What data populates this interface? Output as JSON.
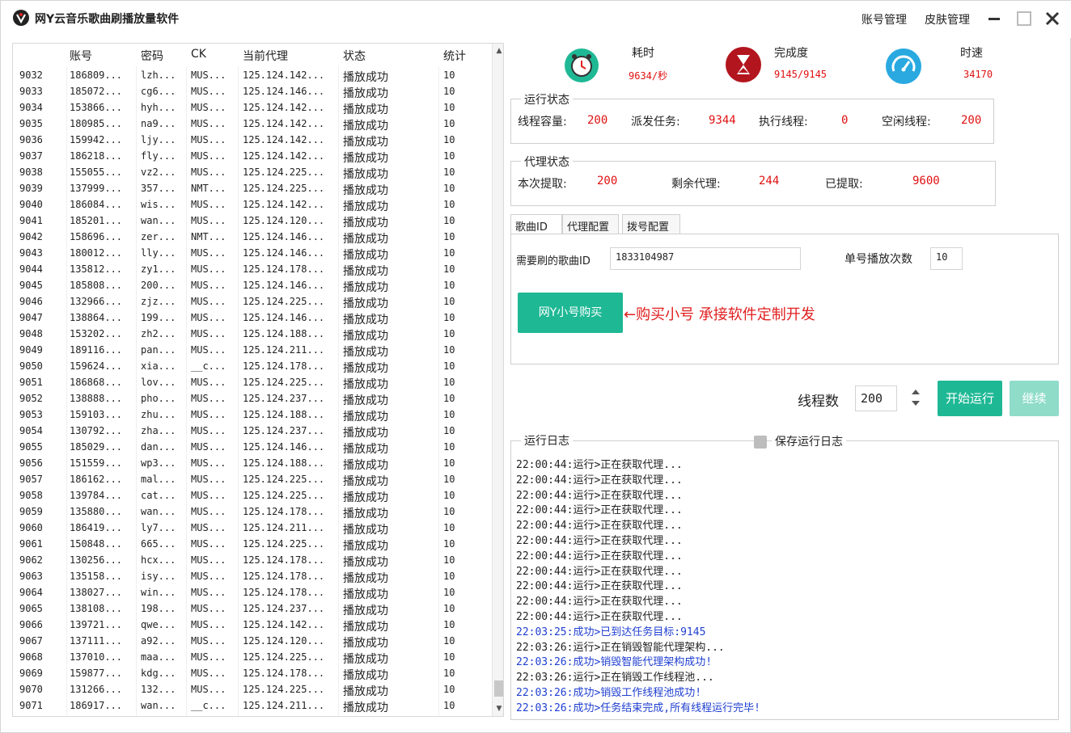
{
  "window": {
    "title": "网Y云音乐歌曲刷播放量软件",
    "account_mgmt": "账号管理",
    "skin_mgmt": "皮肤管理"
  },
  "table": {
    "headers": [
      "账号",
      "密码",
      "CK",
      "当前代理",
      "状态",
      "统计"
    ],
    "rows": [
      [
        "9032",
        "186809...",
        "lzh...",
        "MUS...",
        "125.124.142...",
        "播放成功",
        "10"
      ],
      [
        "9033",
        "185072...",
        "cg6...",
        "MUS...",
        "125.124.146...",
        "播放成功",
        "10"
      ],
      [
        "9034",
        "153866...",
        "hyh...",
        "MUS...",
        "125.124.142...",
        "播放成功",
        "10"
      ],
      [
        "9035",
        "180985...",
        "na9...",
        "MUS...",
        "125.124.142...",
        "播放成功",
        "10"
      ],
      [
        "9036",
        "159942...",
        "ljy...",
        "MUS...",
        "125.124.142...",
        "播放成功",
        "10"
      ],
      [
        "9037",
        "186218...",
        "fly...",
        "MUS...",
        "125.124.142...",
        "播放成功",
        "10"
      ],
      [
        "9038",
        "155055...",
        "vz2...",
        "MUS...",
        "125.124.225...",
        "播放成功",
        "10"
      ],
      [
        "9039",
        "137999...",
        "357...",
        "NMT...",
        "125.124.225...",
        "播放成功",
        "10"
      ],
      [
        "9040",
        "186084...",
        "wis...",
        "MUS...",
        "125.124.142...",
        "播放成功",
        "10"
      ],
      [
        "9041",
        "185201...",
        "wan...",
        "MUS...",
        "125.124.120...",
        "播放成功",
        "10"
      ],
      [
        "9042",
        "158696...",
        "zer...",
        "NMT...",
        "125.124.146...",
        "播放成功",
        "10"
      ],
      [
        "9043",
        "180012...",
        "lly...",
        "MUS...",
        "125.124.146...",
        "播放成功",
        "10"
      ],
      [
        "9044",
        "135812...",
        "zy1...",
        "MUS...",
        "125.124.178...",
        "播放成功",
        "10"
      ],
      [
        "9045",
        "185808...",
        "200...",
        "MUS...",
        "125.124.146...",
        "播放成功",
        "10"
      ],
      [
        "9046",
        "132966...",
        "zjz...",
        "MUS...",
        "125.124.225...",
        "播放成功",
        "10"
      ],
      [
        "9047",
        "138864...",
        "199...",
        "MUS...",
        "125.124.146...",
        "播放成功",
        "10"
      ],
      [
        "9048",
        "153202...",
        "zh2...",
        "MUS...",
        "125.124.188...",
        "播放成功",
        "10"
      ],
      [
        "9049",
        "189116...",
        "pan...",
        "MUS...",
        "125.124.211...",
        "播放成功",
        "10"
      ],
      [
        "9050",
        "159624...",
        "xia...",
        "__c...",
        "125.124.178...",
        "播放成功",
        "10"
      ],
      [
        "9051",
        "186868...",
        "lov...",
        "MUS...",
        "125.124.225...",
        "播放成功",
        "10"
      ],
      [
        "9052",
        "138888...",
        "pho...",
        "MUS...",
        "125.124.237...",
        "播放成功",
        "10"
      ],
      [
        "9053",
        "159103...",
        "zhu...",
        "MUS...",
        "125.124.188...",
        "播放成功",
        "10"
      ],
      [
        "9054",
        "130792...",
        "zha...",
        "MUS...",
        "125.124.237...",
        "播放成功",
        "10"
      ],
      [
        "9055",
        "185029...",
        "dan...",
        "MUS...",
        "125.124.146...",
        "播放成功",
        "10"
      ],
      [
        "9056",
        "151559...",
        "wp3...",
        "MUS...",
        "125.124.188...",
        "播放成功",
        "10"
      ],
      [
        "9057",
        "186162...",
        "mal...",
        "MUS...",
        "125.124.225...",
        "播放成功",
        "10"
      ],
      [
        "9058",
        "139784...",
        "cat...",
        "MUS...",
        "125.124.225...",
        "播放成功",
        "10"
      ],
      [
        "9059",
        "135880...",
        "wan...",
        "MUS...",
        "125.124.178...",
        "播放成功",
        "10"
      ],
      [
        "9060",
        "186419...",
        "ly7...",
        "MUS...",
        "125.124.211...",
        "播放成功",
        "10"
      ],
      [
        "9061",
        "150848...",
        "665...",
        "MUS...",
        "125.124.225...",
        "播放成功",
        "10"
      ],
      [
        "9062",
        "130256...",
        "hcx...",
        "MUS...",
        "125.124.178...",
        "播放成功",
        "10"
      ],
      [
        "9063",
        "135158...",
        "isy...",
        "MUS...",
        "125.124.178...",
        "播放成功",
        "10"
      ],
      [
        "9064",
        "138027...",
        "win...",
        "MUS...",
        "125.124.178...",
        "播放成功",
        "10"
      ],
      [
        "9065",
        "138108...",
        "198...",
        "MUS...",
        "125.124.237...",
        "播放成功",
        "10"
      ],
      [
        "9066",
        "139721...",
        "qwe...",
        "MUS...",
        "125.124.142...",
        "播放成功",
        "10"
      ],
      [
        "9067",
        "137111...",
        "a92...",
        "MUS...",
        "125.124.120...",
        "播放成功",
        "10"
      ],
      [
        "9068",
        "137010...",
        "maa...",
        "MUS...",
        "125.124.225...",
        "播放成功",
        "10"
      ],
      [
        "9069",
        "159877...",
        "kdg...",
        "MUS...",
        "125.124.178...",
        "播放成功",
        "10"
      ],
      [
        "9070",
        "131266...",
        "132...",
        "MUS...",
        "125.124.225...",
        "播放成功",
        "10"
      ],
      [
        "9071",
        "186917...",
        "wan...",
        "__c...",
        "125.124.211...",
        "播放成功",
        "10"
      ]
    ]
  },
  "stats": {
    "time_label": "耗时",
    "time_value": "9634/秒",
    "progress_label": "完成度",
    "progress_value": "9145/9145",
    "speed_label": "时速",
    "speed_value": "34170"
  },
  "run_status": {
    "title": "运行状态",
    "capacity_label": "线程容量:",
    "capacity_value": "200",
    "dispatched_label": "派发任务:",
    "dispatched_value": "9344",
    "executing_label": "执行线程:",
    "executing_value": "0",
    "idle_label": "空闲线程:",
    "idle_value": "200"
  },
  "proxy_status": {
    "title": "代理状态",
    "fetched_label": "本次提取:",
    "fetched_value": "200",
    "remaining_label": "剩余代理:",
    "remaining_value": "244",
    "extracted_label": "已提取:",
    "extracted_value": "9600"
  },
  "tabs": [
    "歌曲ID",
    "代理配置",
    "拨号配置"
  ],
  "song_panel": {
    "song_id_label": "需要刷的歌曲ID",
    "song_id_value": "1833104987",
    "plays_label": "单号播放次数",
    "plays_value": "10",
    "buy_button": "网Y小号购买",
    "promo_text": "←购买小号  承接软件定制开发"
  },
  "controls": {
    "threads_label": "线程数",
    "threads_value": "200",
    "start_button": "开始运行",
    "continue_button": "继续"
  },
  "log": {
    "title": "运行日志",
    "save_label": "保存运行日志",
    "lines": [
      {
        "text": "22:00:44:运行>正在获取代理...",
        "kind": "run"
      },
      {
        "text": "22:00:44:运行>正在获取代理...",
        "kind": "run"
      },
      {
        "text": "22:00:44:运行>正在获取代理...",
        "kind": "run"
      },
      {
        "text": "22:00:44:运行>正在获取代理...",
        "kind": "run"
      },
      {
        "text": "22:00:44:运行>正在获取代理...",
        "kind": "run"
      },
      {
        "text": "22:00:44:运行>正在获取代理...",
        "kind": "run"
      },
      {
        "text": "22:00:44:运行>正在获取代理...",
        "kind": "run"
      },
      {
        "text": "22:00:44:运行>正在获取代理...",
        "kind": "run"
      },
      {
        "text": "22:00:44:运行>正在获取代理...",
        "kind": "run"
      },
      {
        "text": "22:00:44:运行>正在获取代理...",
        "kind": "run"
      },
      {
        "text": "22:00:44:运行>正在获取代理...",
        "kind": "run"
      },
      {
        "text": "22:03:25:成功>已到达任务目标:9145",
        "kind": "ok"
      },
      {
        "text": "22:03:26:运行>正在销毁智能代理架构...",
        "kind": "run"
      },
      {
        "text": "22:03:26:成功>销毁智能代理架构成功!",
        "kind": "ok"
      },
      {
        "text": "22:03:26:运行>正在销毁工作线程池...",
        "kind": "run"
      },
      {
        "text": "22:03:26:成功>销毁工作线程池成功!",
        "kind": "ok"
      },
      {
        "text": "22:03:26:成功>任务结束完成,所有线程运行完毕!",
        "kind": "ok"
      }
    ]
  },
  "colors": {
    "accent": "#1fb895",
    "accent_light": "#8fdcc9",
    "value_red": "#e01010",
    "log_blue": "#1f3fd0"
  }
}
